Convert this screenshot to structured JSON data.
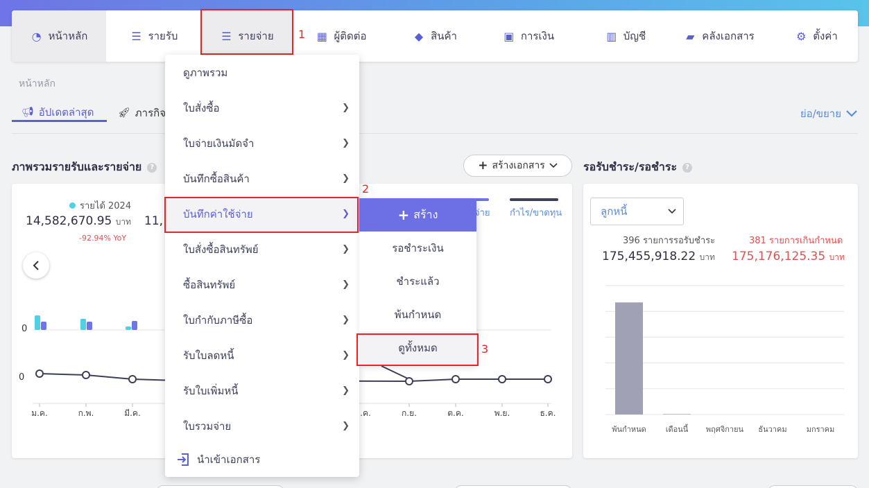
{
  "nav": {
    "items": [
      {
        "label": "หน้าหลัก",
        "icon": "dashboard-icon"
      },
      {
        "label": "รายรับ",
        "icon": "income-list-icon"
      },
      {
        "label": "รายจ่าย",
        "icon": "expense-list-icon"
      },
      {
        "label": "ผู้ติดต่อ",
        "icon": "contacts-icon"
      },
      {
        "label": "สินค้า",
        "icon": "box-icon"
      },
      {
        "label": "การเงิน",
        "icon": "money-icon"
      },
      {
        "label": "บัญชี",
        "icon": "ledger-icon"
      },
      {
        "label": "คลังเอกสาร",
        "icon": "folder-icon"
      },
      {
        "label": "ตั้งค่า",
        "icon": "gear-icon"
      }
    ]
  },
  "annotations": {
    "step1": "1",
    "step2": "2",
    "step3": "3"
  },
  "breadcrumb": "หน้าหลัก",
  "tabs": {
    "update": "อัปเดตล่าสุด",
    "mission": "ภารกิจ"
  },
  "collapse_label": "ย่อ/ขยาย",
  "overview": {
    "title": "ภาพรวมรายรับและรายจ่าย",
    "create_button": "สร้างเอกสาร",
    "income_legend": "รายได้ 2024",
    "income_value": "14,582,670.95",
    "income_unit": "บาท",
    "income_yoy": "-92.94% YoY",
    "second_value_partial": "11,",
    "legend_expense_partial": "จ่าย",
    "legend_profit": "กำไร/ขาดทุน"
  },
  "receivables": {
    "title": "รอรับชำระ/รอชำระ",
    "select_value": "ลูกหนี้",
    "pending_label": "396 รายการรอรับชำระ",
    "pending_value": "175,455,918.22",
    "overdue_label": "381 รายการเกินกำหนด",
    "overdue_value": "175,176,125.35",
    "unit": "บาท"
  },
  "menu": {
    "items": [
      {
        "label": "ดูภาพรวม",
        "has_sub": false
      },
      {
        "label": "ใบสั่งซื้อ",
        "has_sub": true
      },
      {
        "label": "ใบจ่ายเงินมัดจำ",
        "has_sub": true
      },
      {
        "label": "บันทึกซื้อสินค้า",
        "has_sub": true
      },
      {
        "label": "บันทึกค่าใช้จ่าย",
        "has_sub": true
      },
      {
        "label": "ใบสั่งซื้อสินทรัพย์",
        "has_sub": true
      },
      {
        "label": "ซื้อสินทรัพย์",
        "has_sub": true
      },
      {
        "label": "ใบกำกับภาษีซื้อ",
        "has_sub": true
      },
      {
        "label": "รับใบลดหนี้",
        "has_sub": true
      },
      {
        "label": "รับใบเพิ่มหนี้",
        "has_sub": true
      },
      {
        "label": "ใบรวมจ่าย",
        "has_sub": true
      }
    ],
    "import_label": "นำเข้าเอกสาร"
  },
  "submenu": {
    "create": "สร้าง",
    "items": [
      "รอชำระเงิน",
      "ชำระแล้ว",
      "พ้นกำหนด",
      "ดูทั้งหมด"
    ]
  },
  "chart_data": [
    {
      "type": "bar",
      "title": "",
      "categories": [
        "ม.ค.",
        "ก.พ.",
        "มี.ค."
      ],
      "series": [
        {
          "values": [
            21,
            16,
            5
          ]
        },
        {
          "values": [
            12,
            12,
            13
          ]
        }
      ],
      "ylabel_tick": "0",
      "colors": [
        "#4dd1e3",
        "#6f74e6"
      ]
    },
    {
      "type": "line",
      "title": "",
      "categories_visible": [
        "ม.ค.",
        "ก.พ.",
        "มี.ค.",
        "ส.ค.",
        "ก.ย.",
        "ต.ค.",
        "พ.ย.",
        "ธ.ค."
      ],
      "tick_labels": [
        "ม.ค.",
        "ก.พ.",
        "มี.ค.",
        "ิ.ค.",
        "ก.ย.",
        "ต.ค.",
        "พ.ย.",
        "ธ.ค."
      ],
      "values_visible": [
        4,
        2,
        -4,
        -6,
        -7,
        -4,
        -4,
        -4
      ],
      "ylabel_tick": "0",
      "color": "#3c3f58"
    },
    {
      "type": "bar",
      "title": "",
      "categories": [
        "พ้นกำหนด",
        "เดือนนี้",
        "พฤศจิกายน",
        "ธันวาคม",
        "มกราคม"
      ],
      "values": [
        100,
        0.4,
        0,
        0,
        0
      ],
      "ylim": [
        0,
        115
      ],
      "color": "#a1a1b5"
    }
  ]
}
